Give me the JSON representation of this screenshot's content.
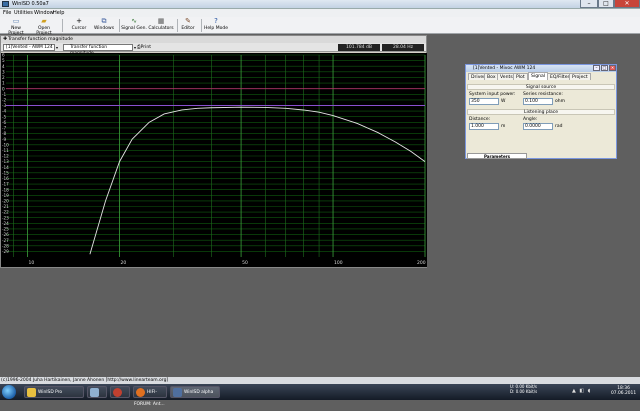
{
  "window": {
    "title": "WinISD 0.50a7",
    "min": "–",
    "max": "□",
    "close": "✕"
  },
  "menu": [
    "File",
    "Utilities",
    "Window",
    "Help"
  ],
  "toolbar": [
    {
      "label": "New Project",
      "icon": "new-file-icon"
    },
    {
      "label": "Open Project",
      "icon": "folder-open-icon"
    },
    {
      "label": "Curcor",
      "icon": "cursor-icon"
    },
    {
      "label": "Windows",
      "icon": "windows-icon"
    },
    {
      "label": "Signal Gen.",
      "icon": "signal-generator-icon"
    },
    {
      "label": "Calculators",
      "icon": "calculator-icon"
    },
    {
      "label": "Editor",
      "icon": "editor-icon"
    },
    {
      "label": "Help Mode",
      "icon": "help-icon"
    }
  ],
  "plot_window": {
    "title": "Transfer function magnitude",
    "project": "[1]Vented - AWM 124",
    "graph_type": "Transfer function magnitude",
    "print": "Print",
    "readout_db": "101.784 dB",
    "readout_hz": "28.04 Hz"
  },
  "chart_data": {
    "type": "line",
    "title": "",
    "xlabel": "",
    "ylabel": "",
    "xscale": "log",
    "xlim": [
      8.5,
      200
    ],
    "ylim": [
      -30,
      6
    ],
    "x_ticks": [
      10,
      20,
      50,
      100,
      200
    ],
    "y_ticks": [
      6,
      5,
      4,
      3,
      2,
      1,
      0,
      -1,
      -2,
      -3,
      -4,
      -5,
      -6,
      -7,
      -8,
      -9,
      -10,
      -11,
      -12,
      -13,
      -14,
      -15,
      -16,
      -17,
      -18,
      -19,
      -20,
      -21,
      -22,
      -23,
      -24,
      -25,
      -26,
      -27,
      -28,
      -29
    ],
    "grid": true,
    "series": [
      {
        "color": "#e4e4e4",
        "x": [
          16,
          18,
          20,
          22,
          25,
          28,
          32,
          36,
          40,
          50,
          60,
          70,
          80,
          90,
          100,
          120,
          140,
          160,
          180,
          200
        ],
        "y": [
          -29.5,
          -20,
          -13,
          -9,
          -6,
          -4.5,
          -3.8,
          -3.5,
          -3.4,
          -3.3,
          -3.35,
          -3.5,
          -3.8,
          -4.2,
          -4.8,
          -6.2,
          -7.8,
          -9.5,
          -11.2,
          -13
        ]
      }
    ],
    "reference_lines": [
      {
        "y": 0,
        "color": "#b0306a"
      },
      {
        "y": -3,
        "color": "#8a4fd0"
      }
    ]
  },
  "signal_window": {
    "title": "[1]Vented - Mivoc AWM 124",
    "tabs": [
      "Driver",
      "Box",
      "Vents",
      "Plot",
      "Signal",
      "EQ/Filter",
      "Project"
    ],
    "active_tab": "Signal",
    "signal_source_header": "Signal source",
    "system_input_power_label": "System input power:",
    "system_input_power_value": "350",
    "system_input_power_unit": "W",
    "series_resistance_label": "Series resistance:",
    "series_resistance_value": "0.100",
    "series_resistance_unit": "ohm",
    "listening_place_header": "Listening place",
    "distance_label": "Distance:",
    "distance_value": "1.000",
    "distance_unit": "m",
    "angle_label": "Angle:",
    "angle_value": "0.0000",
    "angle_unit": "rad",
    "parameters_tab": "Parameters"
  },
  "statusbar": "(c)1996-2004 Juha Hartikainen, Janne Ahonen [http://www.linearteam.org]",
  "taskbar": {
    "items": [
      {
        "label": "WinISD Pro",
        "color": "#e8c040"
      },
      {
        "label": "",
        "color": "#8fb0d0"
      },
      {
        "label": "",
        "color": "#c04030"
      },
      {
        "label": "HIFI-FORUM: Ant...",
        "color": "#e07020"
      },
      {
        "label": "WinISD alpha",
        "color": "#4f6f9f"
      }
    ],
    "tray": [
      "U: 0.00 Kbit/s",
      "D: 0.00 Kbit/s"
    ],
    "time": "18:36",
    "date": "07.06.2011"
  }
}
